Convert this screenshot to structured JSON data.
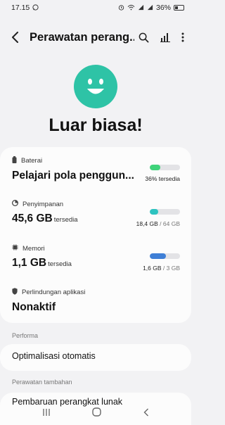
{
  "status_bar": {
    "time": "17.15",
    "battery": "36%",
    "icons": [
      "whatsapp-icon",
      "alarm-icon",
      "wifi-icon",
      "signal-icon",
      "signal-icon",
      "battery-icon"
    ]
  },
  "app_bar": {
    "title": "Perawatan perang...",
    "icons": [
      "back-icon",
      "search-icon",
      "bar-chart-icon",
      "more-icon"
    ]
  },
  "status": {
    "headline": "Luar biasa!",
    "face_color": "#2ec3a6"
  },
  "battery": {
    "label": "Baterai",
    "value": "Pelajari pola penggun...",
    "meter_text": "36% tersedia",
    "level": 0.36,
    "color": "#3fd37a"
  },
  "storage": {
    "label": "Penyimpanan",
    "value": "45,6 GB",
    "unit": "tersedia",
    "used": "18,4 GB",
    "total": "/ 64 GB",
    "level": 0.29,
    "color": "#2ec3c0"
  },
  "memory": {
    "label": "Memori",
    "value": "1,1 GB",
    "unit": "tersedia",
    "used": "1,6 GB",
    "total": "/ 3 GB",
    "level": 0.53,
    "color": "#3f7fd6"
  },
  "protection": {
    "label": "Perlindungan aplikasi",
    "value": "Nonaktif"
  },
  "performance": {
    "section": "Performa",
    "item": "Optimalisasi otomatis"
  },
  "additional_care": {
    "section": "Perawatan tambahan",
    "item": "Pembaruan perangkat lunak"
  },
  "nav_bar": {
    "icons": [
      "recents-icon",
      "home-icon",
      "back-nav-icon"
    ]
  }
}
